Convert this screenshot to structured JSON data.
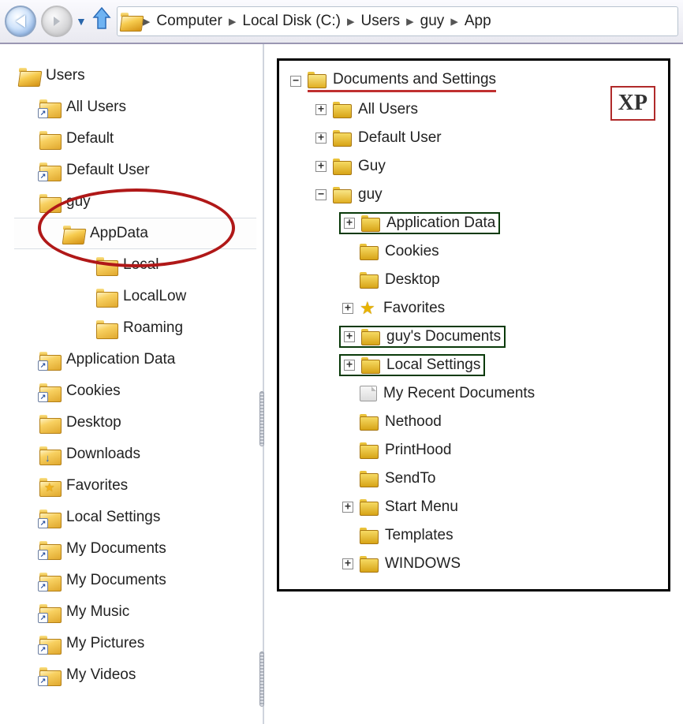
{
  "breadcrumb": {
    "segments": [
      "Computer",
      "Local Disk (C:)",
      "Users",
      "guy",
      "App"
    ]
  },
  "left_tree": {
    "root": "Users",
    "items": [
      {
        "label": "All Users",
        "indent": 1,
        "shortcut": true
      },
      {
        "label": "Default",
        "indent": 1
      },
      {
        "label": "Default User",
        "indent": 1,
        "shortcut": true
      },
      {
        "label": "guy",
        "indent": 1
      },
      {
        "label": "AppData",
        "indent": 2,
        "selected": true
      },
      {
        "label": "Local",
        "indent": 3
      },
      {
        "label": "LocalLow",
        "indent": 3
      },
      {
        "label": "Roaming",
        "indent": 3
      },
      {
        "label": "Application Data",
        "indent": 1,
        "shortcut": true
      },
      {
        "label": "Cookies",
        "indent": 1,
        "shortcut": true
      },
      {
        "label": "Desktop",
        "indent": 1
      },
      {
        "label": "Downloads",
        "indent": 1,
        "overlay": "dl"
      },
      {
        "label": "Favorites",
        "indent": 1,
        "overlay": "star"
      },
      {
        "label": "Local Settings",
        "indent": 1,
        "shortcut": true
      },
      {
        "label": "My Documents",
        "indent": 1,
        "shortcut": true
      },
      {
        "label": "My Documents",
        "indent": 1,
        "shortcut": true
      },
      {
        "label": "My Music",
        "indent": 1,
        "shortcut": true
      },
      {
        "label": "My Pictures",
        "indent": 1,
        "shortcut": true
      },
      {
        "label": "My Videos",
        "indent": 1,
        "shortcut": true
      }
    ]
  },
  "xp_panel": {
    "badge": "XP",
    "title": "Documents and Settings",
    "items": [
      {
        "label": "All Users",
        "indent": 1,
        "exp": "+",
        "underline": false
      },
      {
        "label": "Default User",
        "indent": 1,
        "exp": "+"
      },
      {
        "label": "Guy",
        "indent": 1,
        "exp": "+"
      },
      {
        "label": "guy",
        "indent": 1,
        "exp": "-",
        "open": true
      },
      {
        "label": "Application Data",
        "indent": 2,
        "exp": "+",
        "box": "green"
      },
      {
        "label": "Cookies",
        "indent": 2
      },
      {
        "label": "Desktop",
        "indent": 2
      },
      {
        "label": "Favorites",
        "indent": 2,
        "exp": "+",
        "icon": "star"
      },
      {
        "label": "guy's Documents",
        "indent": 2,
        "exp": "+",
        "box": "green"
      },
      {
        "label": "Local Settings",
        "indent": 2,
        "exp": "+",
        "box": "green"
      },
      {
        "label": "My Recent Documents",
        "indent": 2,
        "icon": "doc"
      },
      {
        "label": "Nethood",
        "indent": 2
      },
      {
        "label": "PrintHood",
        "indent": 2
      },
      {
        "label": "SendTo",
        "indent": 2
      },
      {
        "label": "Start Menu",
        "indent": 2,
        "exp": "+"
      },
      {
        "label": "Templates",
        "indent": 2
      },
      {
        "label": "WINDOWS",
        "indent": 2,
        "exp": "+"
      }
    ]
  }
}
